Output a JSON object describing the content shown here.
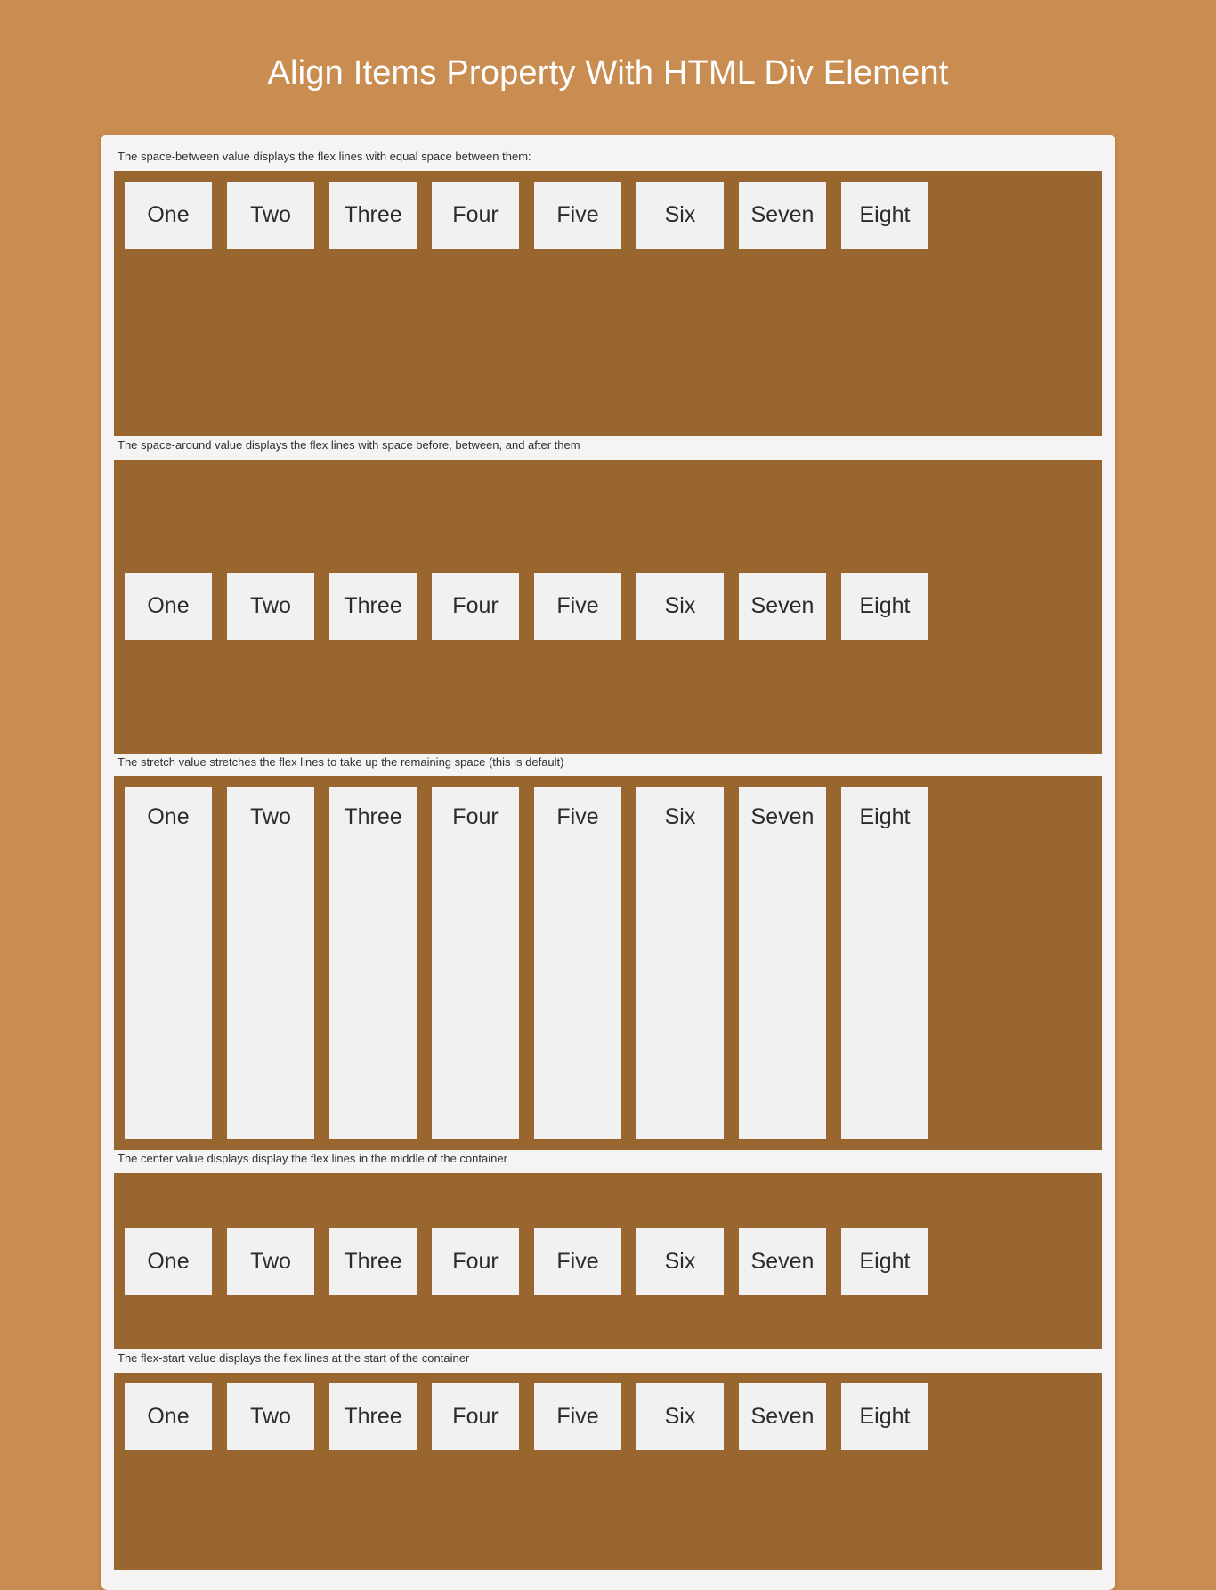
{
  "page": {
    "title": "Align Items Property With HTML Div Element",
    "background_color": "#c98c51",
    "card_background": "#f4f4f2",
    "container_color": "#9a6630",
    "item_color": "#f1f1f1",
    "title_color": "#ffffff",
    "text_color": "#2f2f2f"
  },
  "items": [
    "One",
    "Two",
    "Three",
    "Four",
    "Five",
    "Six",
    "Seven",
    "Eight"
  ],
  "sections": [
    {
      "key": "space-between",
      "description": "The space-between value displays the flex lines with equal space between them:",
      "align_items": "flex-start"
    },
    {
      "key": "space-around",
      "description": "The space-around value displays the flex lines with space before, between, and after them",
      "align_items": "center"
    },
    {
      "key": "stretch",
      "description": "The stretch value stretches the flex lines to take up the remaining space (this is default)",
      "align_items": "stretch"
    },
    {
      "key": "center",
      "description": "The center value displays display the flex lines in the middle of the container",
      "align_items": "center"
    },
    {
      "key": "flex-start",
      "description": "The flex-start value displays the flex lines at the start of the container",
      "align_items": "flex-start"
    }
  ]
}
